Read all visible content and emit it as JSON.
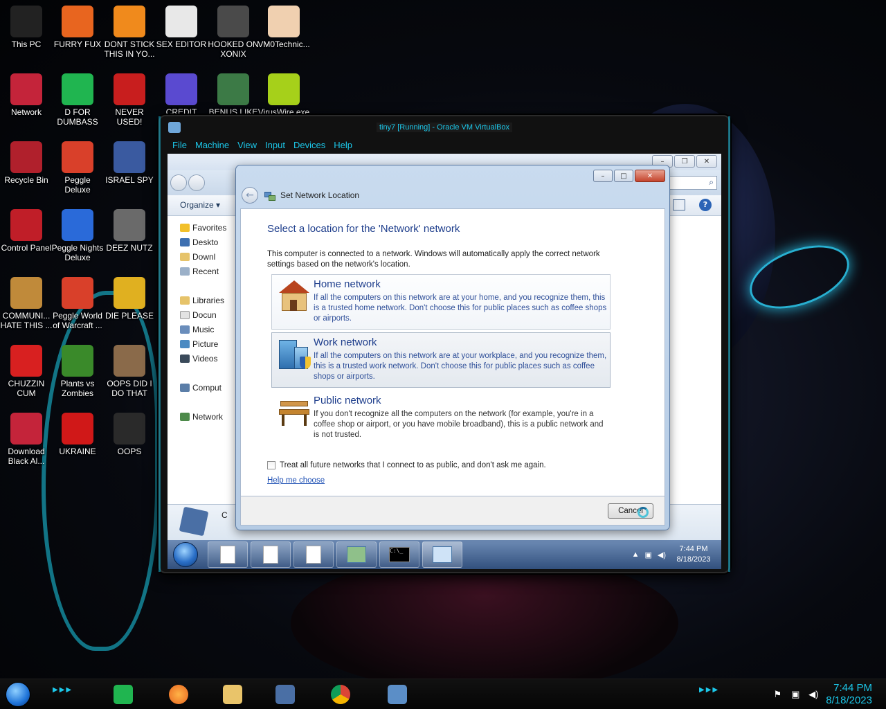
{
  "desktop": {
    "icons": [
      {
        "label": "This PC",
        "icon": "this-pc-icon",
        "color": "#222222"
      },
      {
        "label": "FURRY FUX",
        "icon": "firefox-icon",
        "color": "#e8651f"
      },
      {
        "label": "DONT STICK THIS IN YO...",
        "icon": "vlc-icon",
        "color": "#f08a1c"
      },
      {
        "label": "SEX EDITOR",
        "icon": "hxd-icon",
        "color": "#e8e8e8"
      },
      {
        "label": "HOOKED ON XONIX",
        "icon": "xonix-icon",
        "color": "#4a4a4a"
      },
      {
        "label": "VM0Technic...",
        "icon": "doctor-icon",
        "color": "#f0d0b0"
      },
      {
        "label": "Network",
        "icon": "network-icon",
        "color": "#c4243a"
      },
      {
        "label": "D FOR DUMBASS",
        "icon": "notes-icon",
        "color": "#20b550"
      },
      {
        "label": "NEVER USED!",
        "icon": "devcpp-icon",
        "color": "#c81e1e"
      },
      {
        "label": "CREDIT CARD",
        "icon": "credit-card-icon",
        "color": "#5a4ad0"
      },
      {
        "label": "BENUS LIKE",
        "icon": "santa-icon",
        "color": "#3c7a46"
      },
      {
        "label": "VirusWire.exe",
        "icon": "lime-icon",
        "color": "#a6d01a"
      },
      {
        "label": "Recycle Bin",
        "icon": "recycle-bin-icon",
        "color": "#b0202c"
      },
      {
        "label": "Peggle Deluxe",
        "icon": "peggle-icon",
        "color": "#d9402a"
      },
      {
        "label": "ISRAEL SPY",
        "icon": "spy-icon",
        "color": "#3a5aa0"
      },
      {
        "label": "Control Panel",
        "icon": "control-panel-icon",
        "color": "#c01e28"
      },
      {
        "label": "Peggle Nights Deluxe",
        "icon": "peggle-nights-icon",
        "color": "#2a6ad9"
      },
      {
        "label": "DEEZ NUTZ",
        "icon": "stack-icon",
        "color": "#6a6a6a"
      },
      {
        "label": "COMMUNI... HATE THIS ...",
        "icon": "money-bag-icon",
        "color": "#c08a3a"
      },
      {
        "label": "Peggle World of Warcraft ...",
        "icon": "peggle-wow-icon",
        "color": "#d9402a"
      },
      {
        "label": "DIE PLEASE",
        "icon": "de-icon",
        "color": "#e0b020"
      },
      {
        "label": "CHUZZIN CUM",
        "icon": "chuzzle-icon",
        "color": "#d82020"
      },
      {
        "label": "Plants vs Zombies",
        "icon": "pvz-icon",
        "color": "#3a8a2a"
      },
      {
        "label": "OOPS DID I DO THAT",
        "icon": "portrait-icon",
        "color": "#8a6a4a"
      },
      {
        "label": "Download Black Al...",
        "icon": "black-ops-icon",
        "color": "#c4243a"
      },
      {
        "label": "UKRAINE",
        "icon": "radiation-icon",
        "color": "#d01818"
      },
      {
        "label": "OOPS",
        "icon": "oops-icon",
        "color": "#2a2a2a"
      }
    ]
  },
  "vbox": {
    "title": "tiny7 [Running] - Oracle VM VirtualBox",
    "menu": [
      "File",
      "Machine",
      "View",
      "Input",
      "Devices",
      "Help"
    ]
  },
  "explorer": {
    "organize": "Organize ▾",
    "nav": [
      "Favorites",
      "Deskto",
      "Downl",
      "Recent",
      "Libraries",
      "Docun",
      "Music",
      "Picture",
      "Videos",
      "Comput",
      "Network"
    ],
    "details_cut": "C"
  },
  "dialog": {
    "title": "Set Network Location",
    "heading": "Select a location for the 'Network' network",
    "intro": "This computer is connected to a network. Windows will automatically apply the correct network settings based on the network's location.",
    "options": [
      {
        "title": "Home network",
        "desc": "If all the computers on this network are at your home, and you recognize them, this is a trusted home network.  Don't choose this for public places such as coffee shops or airports."
      },
      {
        "title": "Work network",
        "desc": "If all the computers on this network are at your workplace, and you recognize them, this is a trusted work network.  Don't choose this for public places such as coffee shops or airports."
      },
      {
        "title": "Public network",
        "desc": "If you don't recognize all the computers on the network (for example, you're in a coffee shop or airport, or you have mobile broadband), this is a public network and is not trusted."
      }
    ],
    "checkbox_label": "Treat all future networks that I connect to as public, and don't ask me again.",
    "help_link": "Help me choose",
    "cancel": "Cancel"
  },
  "guest_taskbar": {
    "time": "7:44 PM",
    "date": "8/18/2023"
  },
  "host_taskbar": {
    "time": "7:44 PM",
    "date": "8/18/2023"
  },
  "colors": {
    "accent": "#1cc8ea",
    "link_blue": "#1e50b4",
    "heading_blue": "#1e3e8c"
  }
}
